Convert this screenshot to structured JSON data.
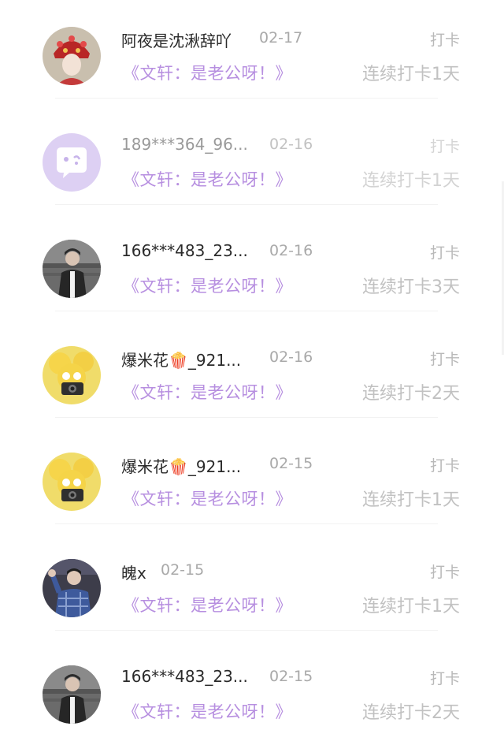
{
  "checkins": [
    {
      "user": "阿夜是沈湫辞吖",
      "date": "02-17",
      "tag": "打卡",
      "book": "《文轩：是老公呀！》",
      "streak": "连续打卡1天",
      "avatar": "opera-headdress-avatar"
    },
    {
      "user": "189***364_96...",
      "date": "02-16",
      "tag": "打卡",
      "book": "《文轩：是老公呀！》",
      "streak": "连续打卡1天",
      "avatar": "default-chat-bubble-avatar"
    },
    {
      "user": "166***483_23...",
      "date": "02-16",
      "tag": "打卡",
      "book": "《文轩：是老公呀！》",
      "streak": "连续打卡3天",
      "avatar": "man-photo-avatar"
    },
    {
      "user": "爆米花🍿_921...",
      "date": "02-16",
      "tag": "打卡",
      "book": "《文轩：是老公呀！》",
      "streak": "连续打卡2天",
      "avatar": "yellow-duck-camera-avatar"
    },
    {
      "user": "爆米花🍿_921...",
      "date": "02-15",
      "tag": "打卡",
      "book": "《文轩：是老公呀！》",
      "streak": "连续打卡1天",
      "avatar": "yellow-duck-camera-avatar"
    },
    {
      "user": "魄x",
      "date": "02-15",
      "tag": "打卡",
      "book": "《文轩：是老公呀！》",
      "streak": "连续打卡1天",
      "avatar": "waving-man-avatar"
    },
    {
      "user": "166***483_23...",
      "date": "02-15",
      "tag": "打卡",
      "book": "《文轩：是老公呀！》",
      "streak": "连续打卡2天",
      "avatar": "man-photo-avatar"
    }
  ],
  "colors": {
    "book_title": "#b78fe0",
    "streak": "#c1c1c1",
    "date": "#a9a9a9",
    "name": "#2a2a2a"
  }
}
